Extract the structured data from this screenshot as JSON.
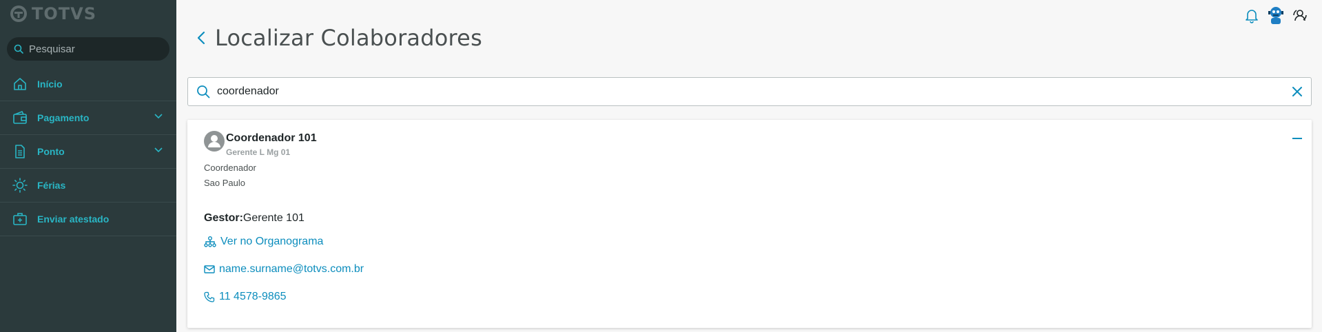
{
  "brand": {
    "logo_text": "TOTVS"
  },
  "sidebar": {
    "search_placeholder": "Pesquisar",
    "items": [
      {
        "label": "Início",
        "icon": "home-icon"
      },
      {
        "label": "Pagamento",
        "icon": "wallet-icon",
        "expandable": true
      },
      {
        "label": "Ponto",
        "icon": "document-icon",
        "expandable": true
      },
      {
        "label": "Férias",
        "icon": "sun-icon"
      },
      {
        "label": "Enviar atestado",
        "icon": "medical-kit-icon"
      }
    ]
  },
  "page": {
    "title": "Localizar Colaboradores"
  },
  "search": {
    "value": "coordenador"
  },
  "result": {
    "name": "Coordenador 101",
    "department": "Gerente L Mg 01",
    "role": "Coordenador",
    "city": "Sao Paulo",
    "manager_label": "Gestor:",
    "manager_value": "Gerente 101",
    "org_link": "Ver no Organograma",
    "email": "name.surname@totvs.com.br",
    "phone": "11 4578-9865"
  },
  "colors": {
    "sidebar_bg": "#2b3a3c",
    "accent": "#29b6c5",
    "link": "#0c8dbd"
  }
}
